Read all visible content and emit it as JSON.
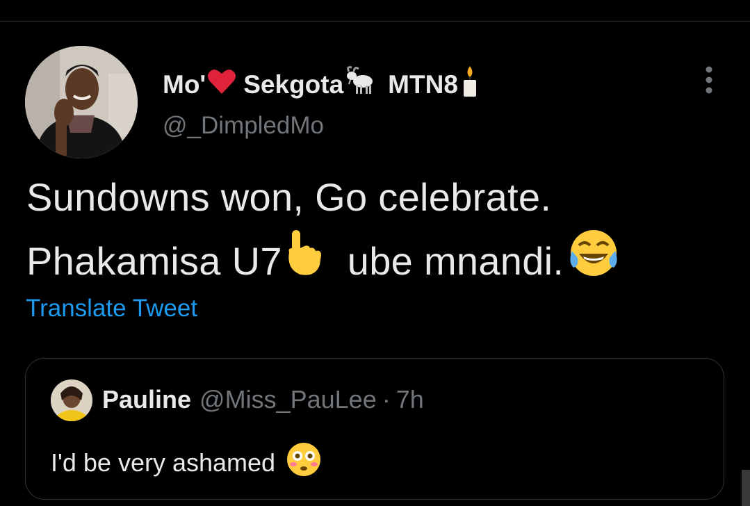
{
  "tweet": {
    "author": {
      "name_part1": "Mo'",
      "name_part2": "Sekgota",
      "name_part3": "MTN8",
      "name_emojis": [
        "heart-icon",
        "goat-icon",
        "candle-icon"
      ],
      "handle": "@_DimpledMo"
    },
    "text_line1": "Sundowns won, Go celebrate.",
    "text_line2_part1": "Phakamisa U7",
    "text_line2_part2": "ube mnandi.",
    "text_emojis": [
      "pointing-up-icon",
      "tears-of-joy-icon"
    ],
    "translate_label": "Translate Tweet",
    "more_menu_icon": "more-vertical-icon"
  },
  "quote": {
    "name": "Pauline",
    "handle": "@Miss_PauLee",
    "separator": "·",
    "time": "7h",
    "text": "I'd be very ashamed",
    "emoji": "flushed-face-icon"
  },
  "colors": {
    "background": "#000000",
    "text": "#e7e9ea",
    "secondary": "#71767b",
    "link": "#1d9bf0",
    "border": "#2f3336"
  }
}
